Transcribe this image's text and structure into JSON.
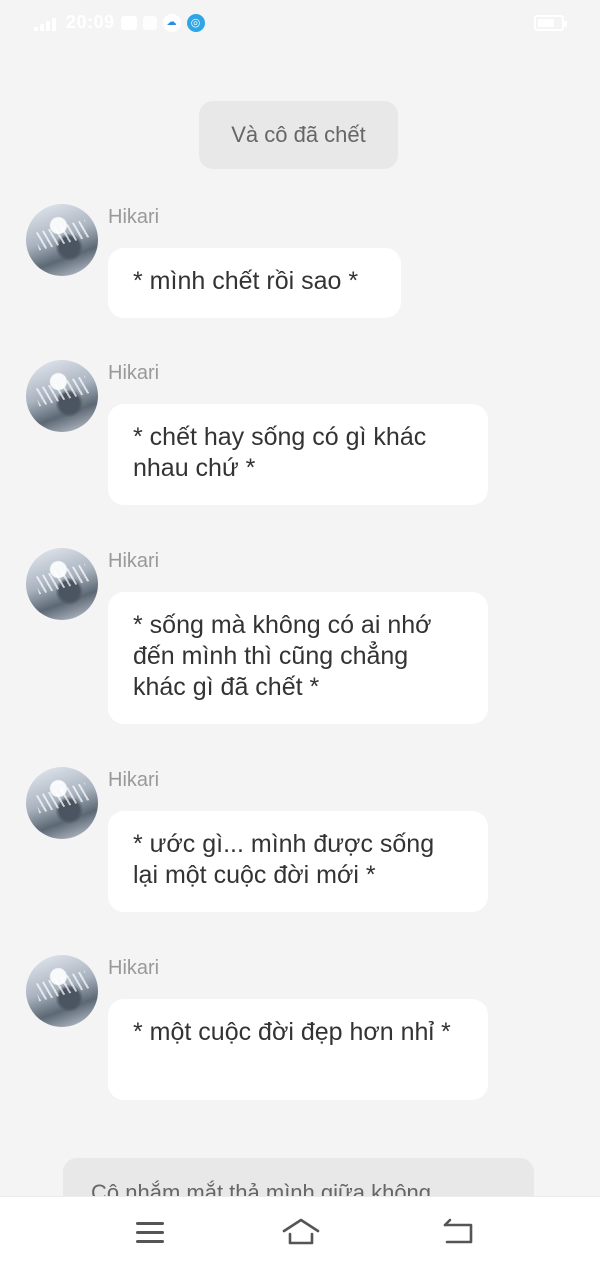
{
  "status_bar": {
    "time": "20:09",
    "icons": [
      "signal-icon",
      "message-icon",
      "notification-dot-icon",
      "cloud-icon",
      "app-ring-icon",
      "battery-icon"
    ]
  },
  "narration_top": "Và cô đã chết",
  "messages": [
    {
      "name": "Hikari",
      "text": "* mình chết rồi sao *"
    },
    {
      "name": "Hikari",
      "text": "* chết hay sống có gì khác nhau chứ *"
    },
    {
      "name": "Hikari",
      "text": "* sống mà không có ai nhớ đến mình thì cũng chẳng khác gì đã chết *"
    },
    {
      "name": "Hikari",
      "text": "* ước gì... mình được sống lại một cuộc đời mới *"
    },
    {
      "name": "Hikari",
      "text": "* một cuộc đời đẹp hơn nhỉ *"
    }
  ],
  "narration_bottom": "Cô nhắm mắt thả mình giữa không",
  "nav": {
    "icons": [
      "menu-icon",
      "home-icon",
      "back-icon"
    ]
  },
  "colors": {
    "background": "#f4f4f4",
    "bubble": "#ffffff",
    "narration": "#e8e8e8",
    "name_text": "#999999",
    "message_text": "#333333"
  }
}
